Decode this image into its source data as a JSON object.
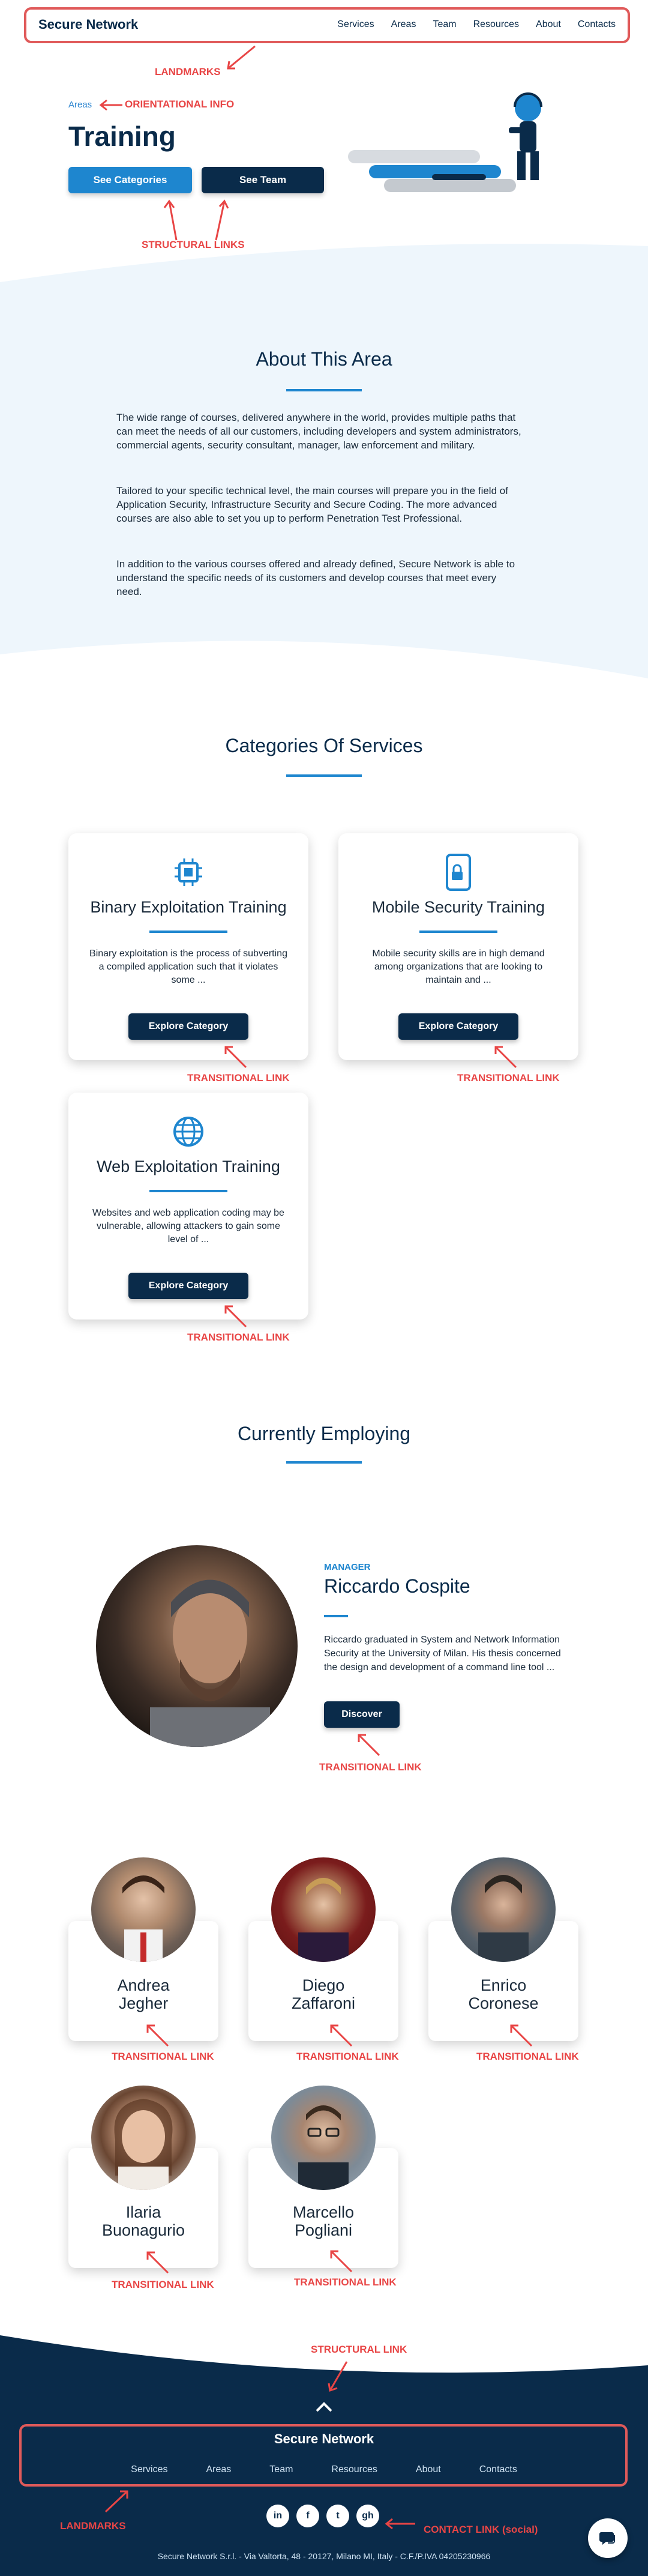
{
  "header": {
    "brand": "Secure Network",
    "nav": [
      "Services",
      "Areas",
      "Team",
      "Resources",
      "About",
      "Contacts"
    ]
  },
  "annotations": {
    "landmarks_top": "LANDMARKS",
    "orientational": "ORIENTATIONAL INFO",
    "structural_links": "STRUCTURAL LINKS",
    "transitional_link": "TRANSITIONAL LINK",
    "structural_link": "STRUCTURAL LINK",
    "landmarks_bottom": "LANDMARKS",
    "contact_link": "CONTACT LINK (social)"
  },
  "hero": {
    "breadcrumb": "Areas",
    "title": "Training",
    "btn_categories": "See Categories",
    "btn_team": "See Team"
  },
  "about": {
    "title": "About This Area",
    "paragraphs": [
      "The wide range of courses, delivered anywhere in the world, provides multiple paths that can meet the needs of all our customers, including developers and system administrators, commercial agents, security consultant, manager, law enforcement and military.",
      "Tailored to your specific technical level, the main courses will prepare you in the field of Application Security, Infrastructure Security and Secure Coding. The more advanced courses are also able to set you up to perform Penetration Test Professional.",
      "In addition to the various courses offered and already defined, Secure Network is able to understand the specific needs of its customers and develop courses that meet every need."
    ]
  },
  "categories": {
    "title": "Categories Of Services",
    "items": [
      {
        "title": "Binary Exploitation Training",
        "desc": "Binary exploitation is the process of subverting a compiled application such that it violates some ...",
        "button": "Explore Category",
        "icon": "chip-icon"
      },
      {
        "title": "Mobile Security Training",
        "desc": "Mobile security skills are in high demand among organizations that are looking to maintain and ...",
        "button": "Explore Category",
        "icon": "mobile-lock-icon"
      },
      {
        "title": "Web Exploitation Training",
        "desc": "Websites and web application coding may be vulnerable, allowing attackers to gain some level of ...",
        "button": "Explore Category",
        "icon": "globe-icon"
      }
    ]
  },
  "employing": {
    "title": "Currently Employing",
    "manager": {
      "role": "MANAGER",
      "name": "Riccardo Cospite",
      "bio": "Riccardo graduated in System and Network Information Security at the University of Milan. His thesis concerned the design and development of a command line tool ...",
      "button": "Discover"
    },
    "team": [
      {
        "name_line1": "Andrea",
        "name_line2": "Jegher"
      },
      {
        "name_line1": "Diego",
        "name_line2": "Zaffaroni"
      },
      {
        "name_line1": "Enrico",
        "name_line2": "Coronese"
      },
      {
        "name_line1": "Ilaria",
        "name_line2": "Buonagurio"
      },
      {
        "name_line1": "Marcello",
        "name_line2": "Pogliani"
      }
    ]
  },
  "footer": {
    "brand": "Secure Network",
    "nav": [
      "Services",
      "Areas",
      "Team",
      "Resources",
      "About",
      "Contacts"
    ],
    "social": [
      "in",
      "f",
      "t",
      "gh"
    ],
    "copyright": "Secure Network S.r.l. - Via Valtorta, 48 - 20127, Milano MI, Italy - C.F./P.IVA 04205230966"
  },
  "colors": {
    "navy": "#0a2b4a",
    "accent": "#1e86cf",
    "annotation_red": "#e84545"
  }
}
